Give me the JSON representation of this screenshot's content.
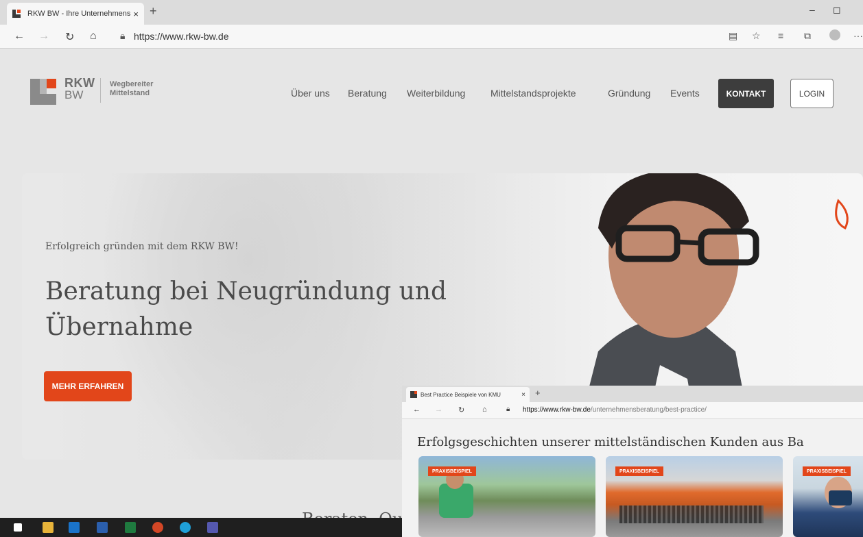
{
  "browser": {
    "tab_title": "RKW BW - Ihre Unternehmensbe",
    "tab_close": "×",
    "new_tab": "+",
    "url": "https://www.rkw-bw.de",
    "minimize": "–",
    "restore": "◻",
    "more": "···"
  },
  "logo": {
    "rkw": "RKW",
    "bw": "BW",
    "tagline_1": "Wegbereiter",
    "tagline_2": "Mittelstand"
  },
  "nav": {
    "items": [
      "Über uns",
      "Beratung",
      "Weiterbildung",
      "Mittelstandsprojekte",
      "Gründung",
      "Events"
    ],
    "kontakt": "KONTAKT",
    "login": "LOGIN"
  },
  "hero": {
    "kicker": "Erfolgreich gründen mit dem RKW BW!",
    "title": "Beratung bei Neugründung und Übernahme",
    "button": "MEHR ERFAHREN"
  },
  "below": {
    "partial_heading": "Beraten. Qu"
  },
  "inset": {
    "tab_title": "Best Practice Beispiele von KMU",
    "tab_close": "×",
    "new_tab": "+",
    "url_domain": "https://www.rkw-bw.de",
    "url_path": "/unternehmensberatung/best-practice/",
    "heading": "Erfolgsgeschichten unserer mittelständischen Kunden aus Ba",
    "badges": [
      "PRAXISBEISPIEL",
      "PRAXISBEISPIEL",
      "PRAXISBEISPIEL"
    ]
  },
  "colors": {
    "accent": "#e2461a",
    "dark_button": "#3d3d3d",
    "page_bg": "#e6e6e6"
  }
}
